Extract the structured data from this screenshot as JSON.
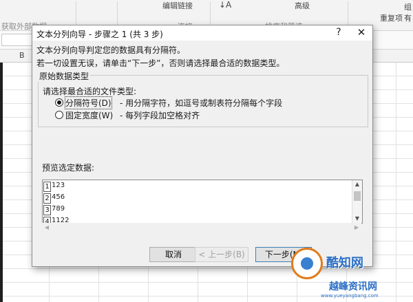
{
  "excel": {
    "ribbon": {
      "get_external_data": "获取外部数据",
      "connections_group": "连接",
      "edit_links": "编辑链接",
      "sort_filter_group": "排序和筛选",
      "advanced": "高级",
      "reapply": "重复项",
      "right_edge_1": "组",
      "right_edge_2": "有"
    },
    "column_b": "B"
  },
  "dialog": {
    "title": "文本分列向导 - 步骤之 1 (共 3 步)",
    "help_label": "?",
    "close_label": "✕",
    "intro_line1": "文本分列向导判定您的数据具有分隔符。",
    "intro_line2": "若一切设置无误，请单击“下一步”，否则请选择最合适的数据类型。",
    "group_title": "原始数据类型",
    "choose_label": "请选择最合适的文件类型:",
    "options": [
      {
        "label": "分隔符号(D)",
        "desc": "- 用分隔字符，如逗号或制表符分隔每个字段",
        "selected": true
      },
      {
        "label": "固定宽度(W)",
        "desc": "- 每列字段加空格对齐",
        "selected": false
      }
    ],
    "preview_label": "预览选定数据:",
    "preview_rows": [
      {
        "num": "1",
        "value": "123"
      },
      {
        "num": "2",
        "value": "456"
      },
      {
        "num": "3",
        "value": "789"
      },
      {
        "num": "4",
        "value": "1122"
      }
    ],
    "buttons": {
      "cancel": "取消",
      "back": "< 上一步(B)",
      "next": "下一步(N)"
    }
  },
  "watermark": {
    "text1": "酷知网",
    "text2": "越峰资讯网",
    "url": "www.yueyangbang.com"
  }
}
